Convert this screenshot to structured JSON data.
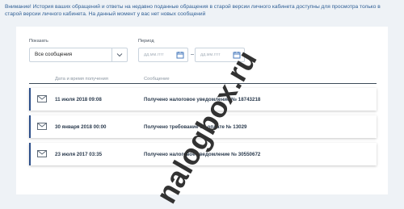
{
  "notice": "Внимание! История ваших обращений и ответы на недавно поданные обращения в старой версии личного кабинета доступны для просмотра только в старой версии личного кабинета. На данный момент у вас нет новых сообщений",
  "filters": {
    "show_label": "Показать",
    "show_value": "Все сообщения",
    "period_label": "Период",
    "date_from_placeholder": "дд.мм.гггг",
    "date_to_placeholder": "дд.мм.гггг"
  },
  "table": {
    "headers": [
      "Дата и время получения",
      "Сообщение"
    ],
    "rows": [
      {
        "date": "11 июля 2018 09:08",
        "message": "Получено налоговое уведомление № 18743218"
      },
      {
        "date": "30 января 2018 00:00",
        "message": "Получено требование об оплате № 13029"
      },
      {
        "date": "23 июля 2017 03:35",
        "message": "Получено налоговое уведомление № 30550672"
      }
    ]
  },
  "watermark": "nalogbox.ru",
  "colors": {
    "accent": "#2d4f8a",
    "notice": "#2f5f95",
    "background": "#eef2f6"
  }
}
